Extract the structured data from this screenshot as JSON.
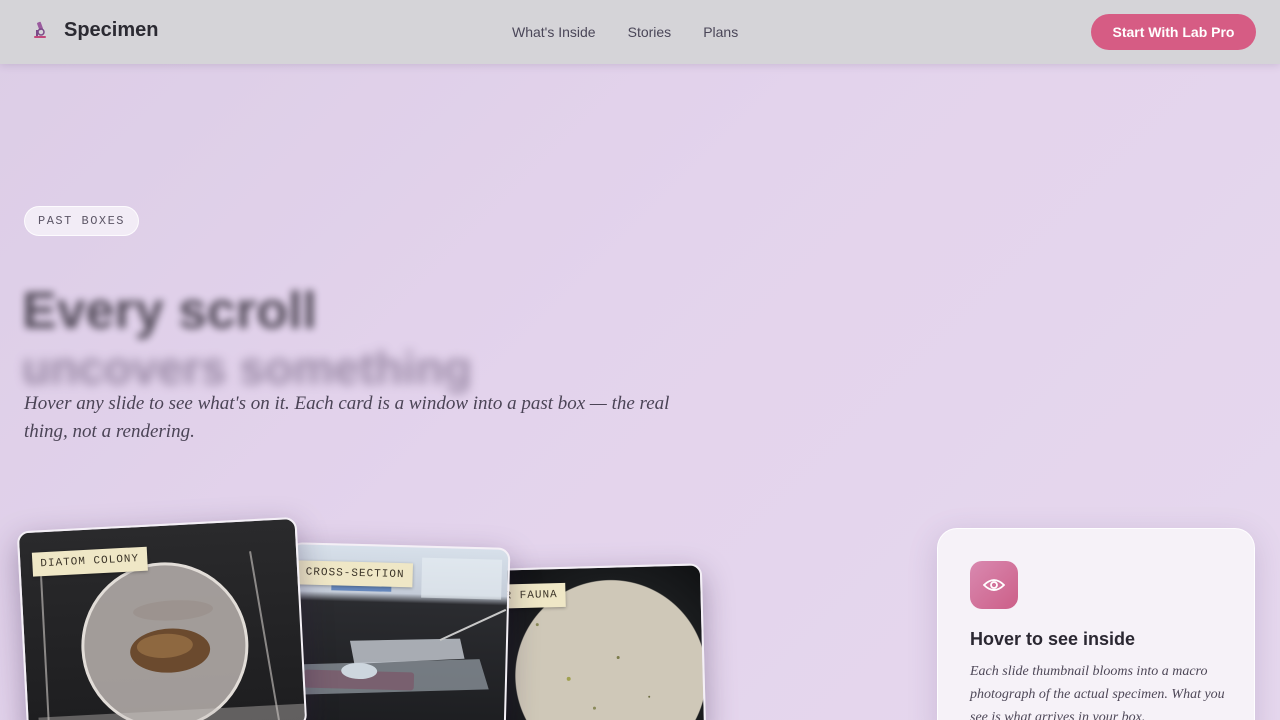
{
  "header": {
    "brand": "Specimen",
    "brand_icon": "microscope-icon",
    "nav": [
      "What's Inside",
      "Stories",
      "Plans"
    ],
    "cta_label": "Start With Lab Pro",
    "accent_color": "#d65c84"
  },
  "hero": {
    "eyebrow": "PAST BOXES",
    "headline": "Every scroll",
    "headline_line2": "uncovers something",
    "lede": "Hover any slide to see what's on it. Each card is a window into a past box — the real thing, not a rendering."
  },
  "slides": [
    {
      "label": "DIATOM COLONY"
    },
    {
      "label": "CROSS-SECTION"
    },
    {
      "label": "R FAUNA"
    }
  ],
  "info_card": {
    "icon": "eye-icon",
    "title": "Hover to see inside",
    "body": "Each slide thumbnail blooms into a macro photograph of the actual specimen. What you see is what arrives in your box."
  }
}
